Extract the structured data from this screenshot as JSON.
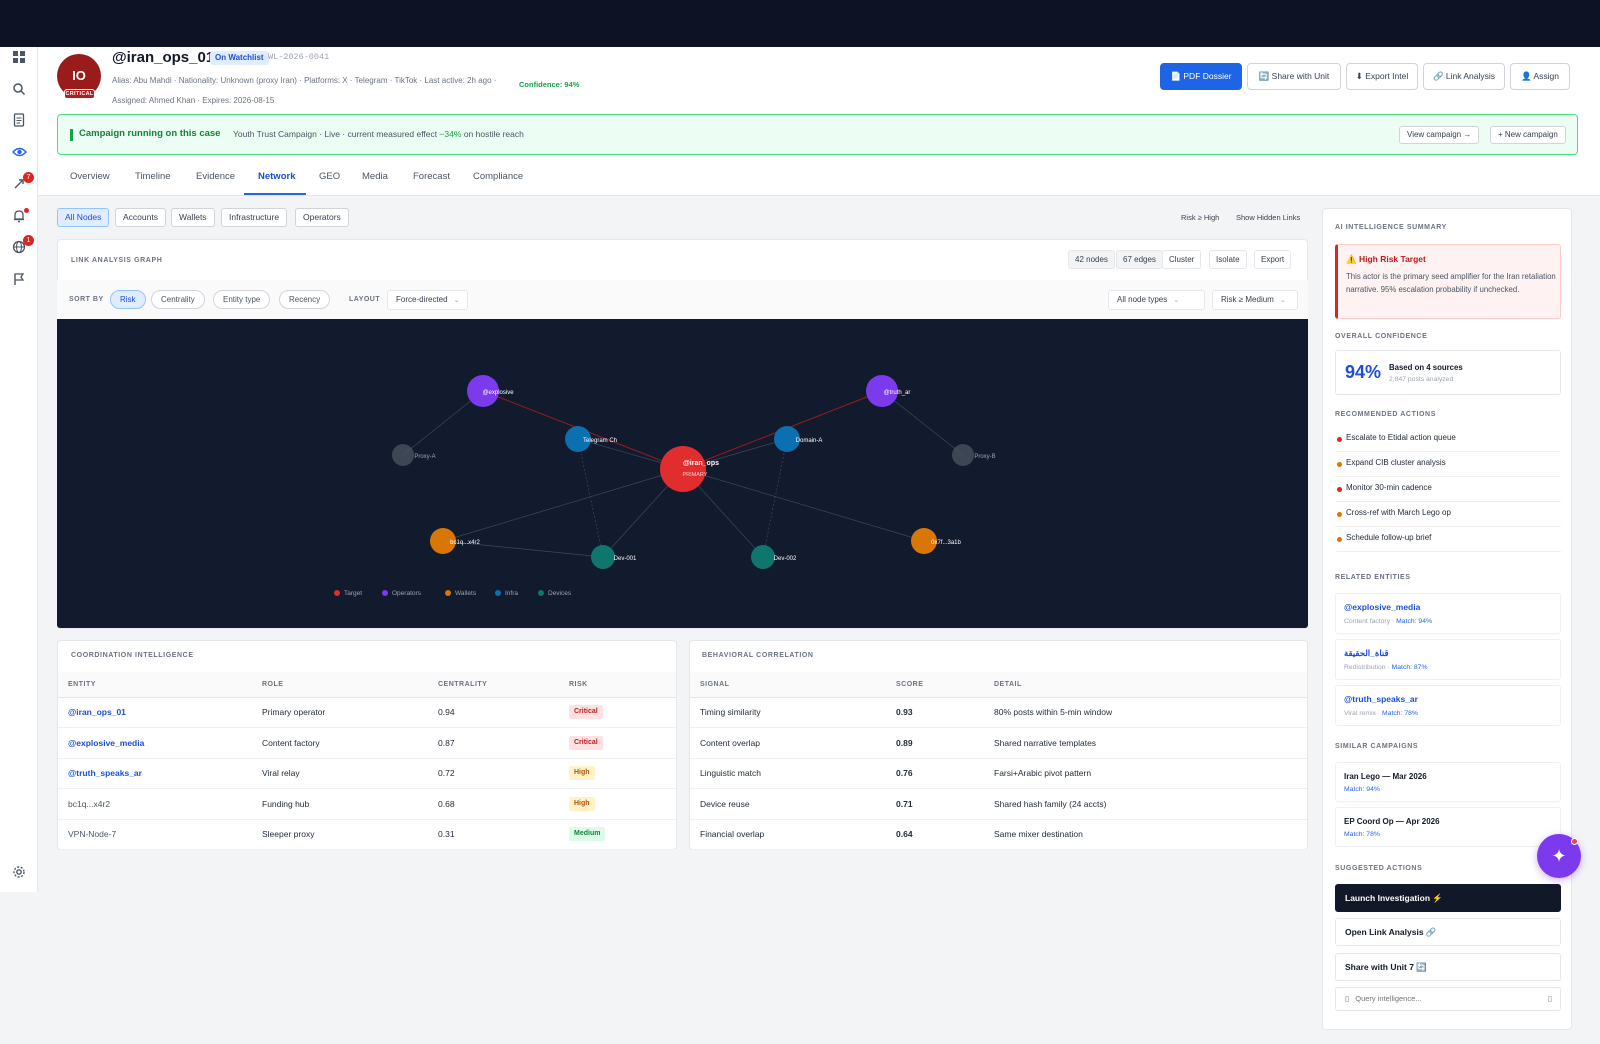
{
  "profile": {
    "initials": "IO",
    "severity": "CRITICAL",
    "handle": "@iran_ops_01",
    "watch_badge": "On Watchlist",
    "case_id": "WL-2026-0041",
    "meta_line": "Alias: Abu Mahdi · Nationality: Unknown (proxy Iran) · Platforms: X · Telegram · TikTok · Last active: 2h ago ·",
    "confidence": "Confidence: 94%",
    "assignment": "Assigned: Ahmed Khan · Expires: 2026-08-15"
  },
  "header_actions": {
    "pdf": "📄 PDF Dossier",
    "share": "🔄 Share with Unit",
    "export": "⬇ Export Intel",
    "link": "🔗 Link Analysis",
    "assign": "👤 Assign"
  },
  "banner": {
    "title": "Campaign running on this case",
    "desc_prefix": "Youth Trust Campaign · Live · current measured effect ",
    "effect": "−34%",
    "desc_suffix": " on hostile reach",
    "view": "View campaign →",
    "new": "+ New campaign"
  },
  "tabs": [
    "Overview",
    "Timeline",
    "Evidence",
    "Network",
    "GEO",
    "Media",
    "Forecast",
    "Compliance"
  ],
  "filters": [
    "All Nodes",
    "Accounts",
    "Wallets",
    "Infrastructure",
    "Operators"
  ],
  "top_links": {
    "risk": "Risk ≥ High",
    "hidden": "Show Hidden Links"
  },
  "graph_card": {
    "title": "LINK ANALYSIS GRAPH",
    "nodes": "42 nodes",
    "edges": "67 edges",
    "cluster": "Cluster",
    "isolate": "Isolate",
    "export": "Export",
    "sort_label": "SORT BY",
    "sort": [
      "Risk",
      "Centrality",
      "Entity type",
      "Recency"
    ],
    "layout_label": "LAYOUT",
    "layout": "Force-directed",
    "node_types": "All node types",
    "risk_filter": "Risk ≥ Medium",
    "graph_nodes": [
      "@explosive",
      "@truth_ar",
      "Proxy-A",
      "Proxy-B",
      "Telegram Ch",
      "Domain-A",
      "@iran_ops",
      "PRIMARY",
      "bc1q...x4r2",
      "0x7f...3a1b",
      "Dev-001",
      "Dev-002"
    ],
    "legend": [
      "Target",
      "Operators",
      "Wallets",
      "Infra",
      "Devices"
    ],
    "colors": {
      "target": "#e12d2d",
      "operators": "#7c3aed",
      "wallets": "#d97706",
      "infra": "#0b6fb0",
      "devices": "#0f766e",
      "proxy": "#4b5563"
    }
  },
  "coordination": {
    "title": "COORDINATION INTELLIGENCE",
    "headers": [
      "ENTITY",
      "ROLE",
      "CENTRALITY",
      "RISK"
    ],
    "rows": [
      {
        "entity": "@iran_ops_01",
        "role": "Primary operator",
        "centrality": "0.94",
        "risk": "Critical"
      },
      {
        "entity": "@explosive_media",
        "role": "Content factory",
        "centrality": "0.87",
        "risk": "Critical"
      },
      {
        "entity": "@truth_speaks_ar",
        "role": "Viral relay",
        "centrality": "0.72",
        "risk": "High"
      },
      {
        "entity": "bc1q...x4r2",
        "role": "Funding hub",
        "centrality": "0.68",
        "risk": "High"
      },
      {
        "entity": "VPN-Node-7",
        "role": "Sleeper proxy",
        "centrality": "0.31",
        "risk": "Medium"
      }
    ]
  },
  "behavioral": {
    "title": "BEHAVIORAL CORRELATION",
    "headers": [
      "SIGNAL",
      "SCORE",
      "DETAIL"
    ],
    "rows": [
      {
        "signal": "Timing similarity",
        "score": "0.93",
        "detail": "80% posts within 5-min window"
      },
      {
        "signal": "Content overlap",
        "score": "0.89",
        "detail": "Shared narrative templates"
      },
      {
        "signal": "Linguistic match",
        "score": "0.76",
        "detail": "Farsi+Arabic pivot pattern"
      },
      {
        "signal": "Device reuse",
        "score": "0.71",
        "detail": "Shared hash family (24 accts)"
      },
      {
        "signal": "Financial overlap",
        "score": "0.64",
        "detail": "Same mixer destination"
      }
    ]
  },
  "ai_panel": {
    "title": "AI INTELLIGENCE SUMMARY",
    "risk_title": "⚠️ High Risk Target",
    "risk_desc": "This actor is the primary seed amplifier for the Iran retaliation narrative. 95% escalation probability if unchecked.",
    "conf_title": "OVERALL CONFIDENCE",
    "conf_value": "94%",
    "conf_basis": "Based on 4 sources",
    "conf_posts": "2,847 posts analyzed",
    "rec_title": "RECOMMENDED ACTIONS",
    "actions": [
      {
        "label": "Escalate to Etidal action queue",
        "color": "#dc2626"
      },
      {
        "label": "Expand CIB cluster analysis",
        "color": "#d97706"
      },
      {
        "label": "Monitor 30-min cadence",
        "color": "#dc2626"
      },
      {
        "label": "Cross-ref with March Lego op",
        "color": "#d97706"
      },
      {
        "label": "Schedule follow-up brief",
        "color": "#d97706"
      }
    ],
    "related_title": "RELATED ENTITIES",
    "related": [
      {
        "name": "@explosive_media",
        "role": "Content factory · ",
        "match": "Match: 94%"
      },
      {
        "name": "قناة_الحقيقة",
        "role": "Redistribution · ",
        "match": "Match: 87%"
      },
      {
        "name": "@truth_speaks_ar",
        "role": "Viral remix · ",
        "match": "Match: 78%"
      }
    ],
    "similar_title": "SIMILAR CAMPAIGNS",
    "similar": [
      {
        "name": "Iran Lego — Mar 2026",
        "match": "Match: 94%"
      },
      {
        "name": "EP Coord Op — Apr 2026",
        "match": "Match: 78%"
      }
    ],
    "suggested_title": "SUGGESTED ACTIONS",
    "launch": "Launch Investigation ⚡",
    "open_link": "Open Link Analysis 🔗",
    "share_unit": "Share with Unit 7 🔄",
    "query_placeholder": "Query intelligence..."
  },
  "rail": {
    "alerts_badge": "7",
    "globe_badge": "1"
  }
}
